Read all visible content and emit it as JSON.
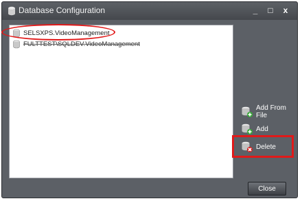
{
  "window": {
    "title": "Database Configuration",
    "minimize_label": "_",
    "maximize_label": "□",
    "close_label": "x"
  },
  "databases": [
    {
      "label": "SELSXPS.VideoManagement",
      "highlighted": true
    },
    {
      "label": "FULTTEST\\SQLDEV.VideoManagement",
      "highlighted": false
    }
  ],
  "actions": {
    "add_from_file": "Add From File",
    "add": "Add",
    "delete": "Delete"
  },
  "footer": {
    "close_button": "Close"
  },
  "colors": {
    "window_bg": "#5c6066",
    "highlight": "#e11919",
    "list_bg": "#ffffff"
  },
  "icons": {
    "title": "database-icon",
    "item": "database-icon",
    "add_from_file": "add-from-file-icon",
    "add": "add-icon",
    "delete": "delete-icon"
  }
}
